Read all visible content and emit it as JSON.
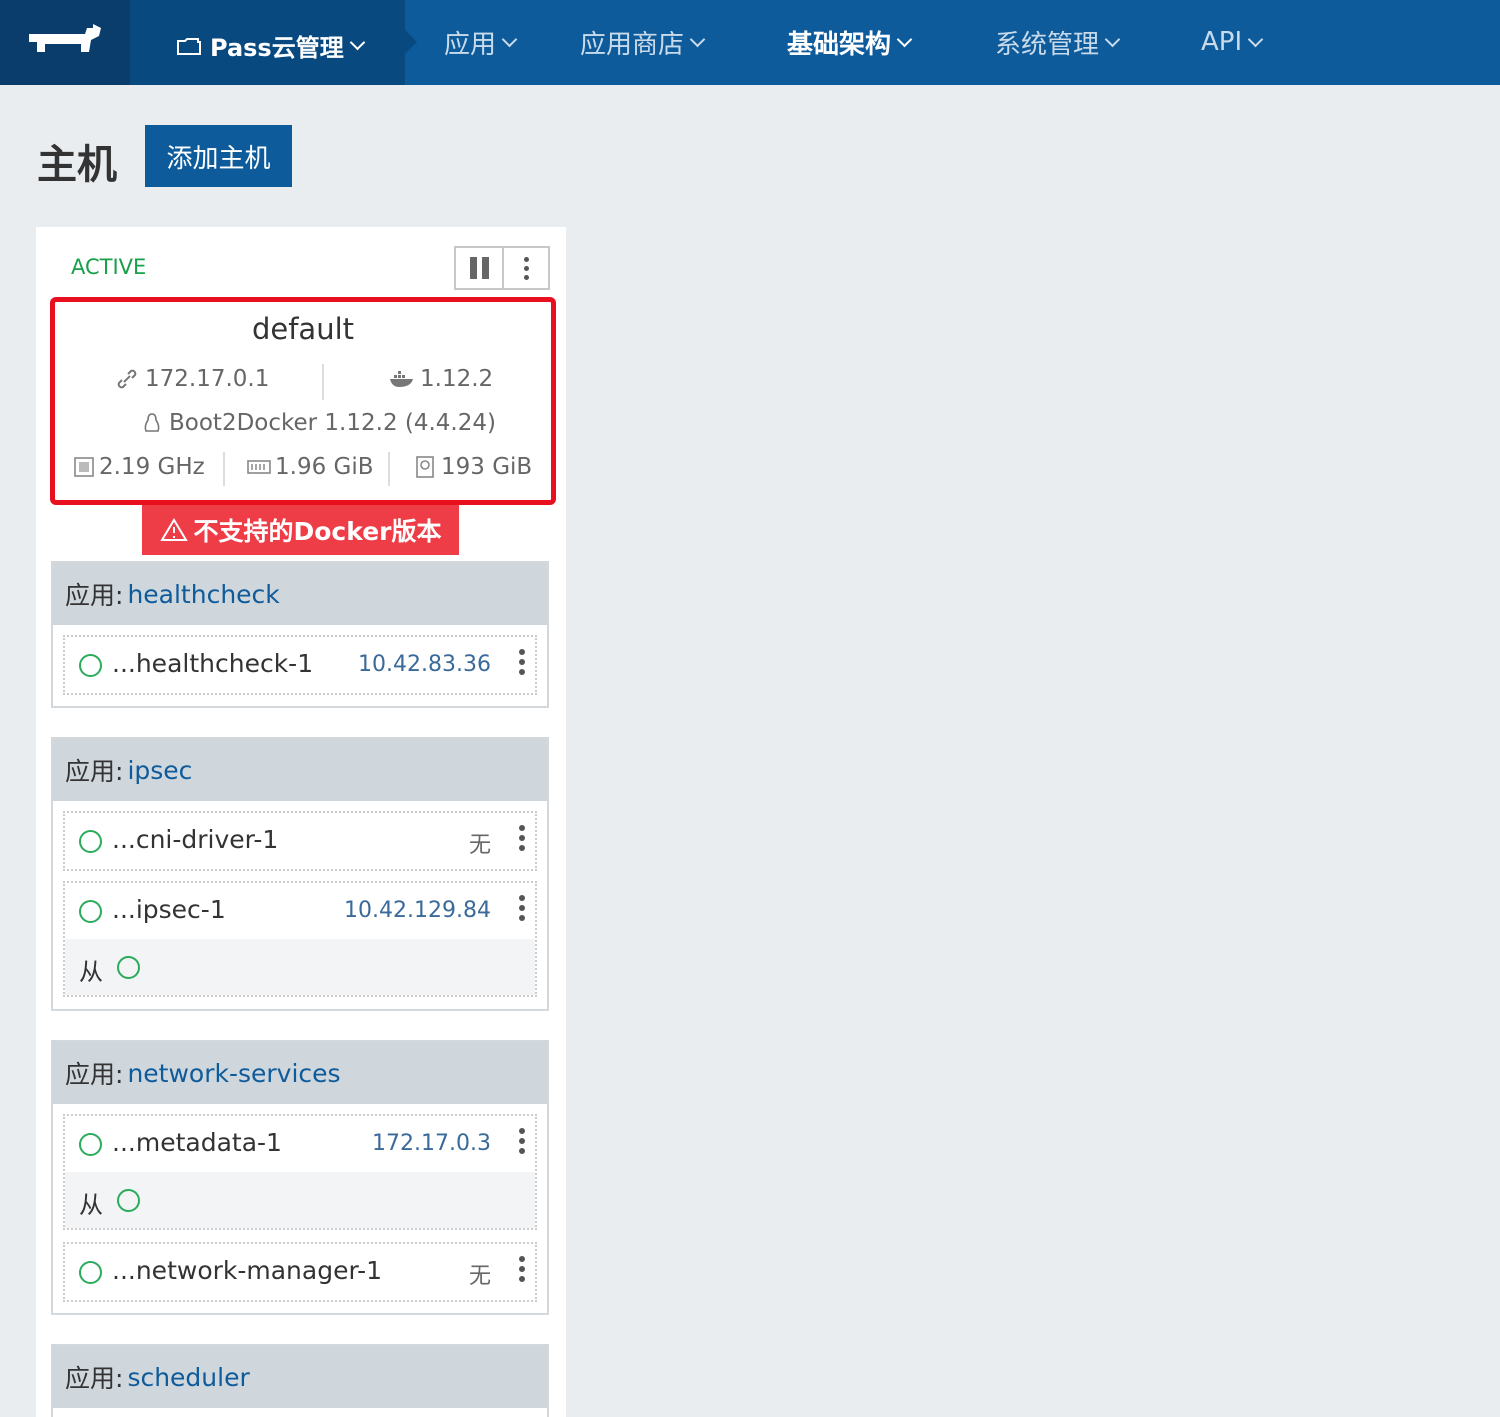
{
  "nav": {
    "environment": "Pass云管理",
    "items": [
      {
        "label": "应用",
        "active": false
      },
      {
        "label": "应用商店",
        "active": false
      },
      {
        "label": "基础架构",
        "active": true
      },
      {
        "label": "系统管理",
        "active": false
      },
      {
        "label": "API",
        "active": false
      }
    ]
  },
  "page": {
    "title": "主机",
    "add_button": "添加主机"
  },
  "host": {
    "state": "ACTIVE",
    "name": "default",
    "ip": "172.17.0.1",
    "docker_version": "1.12.2",
    "os": "Boot2Docker 1.12.2 (4.4.24)",
    "cpu": "2.19 GHz",
    "memory": "1.96 GiB",
    "storage": "193 GiB",
    "warning": "不支持的Docker版本"
  },
  "stack_label": "应用:",
  "sidekick_label": "从",
  "stacks": [
    {
      "name": "healthcheck",
      "instances": [
        {
          "name": "...healthcheck-1",
          "ip": "10.42.83.36"
        }
      ]
    },
    {
      "name": "ipsec",
      "instances": [
        {
          "name": "...cni-driver-1",
          "ip": "无"
        },
        {
          "name": "...ipsec-1",
          "ip": "10.42.129.84"
        }
      ]
    },
    {
      "name": "network-services",
      "instances": [
        {
          "name": "...metadata-1",
          "ip": "172.17.0.3"
        },
        {
          "name": "...network-manager-1",
          "ip": "无"
        }
      ]
    },
    {
      "name": "scheduler",
      "instances": []
    }
  ],
  "colors": {
    "nav_bg": "#0e5b9c",
    "accent": "#0e5b9c",
    "active_green": "#19a04a",
    "warning_red": "#ee3d47",
    "highlight_red": "#e8101e"
  }
}
